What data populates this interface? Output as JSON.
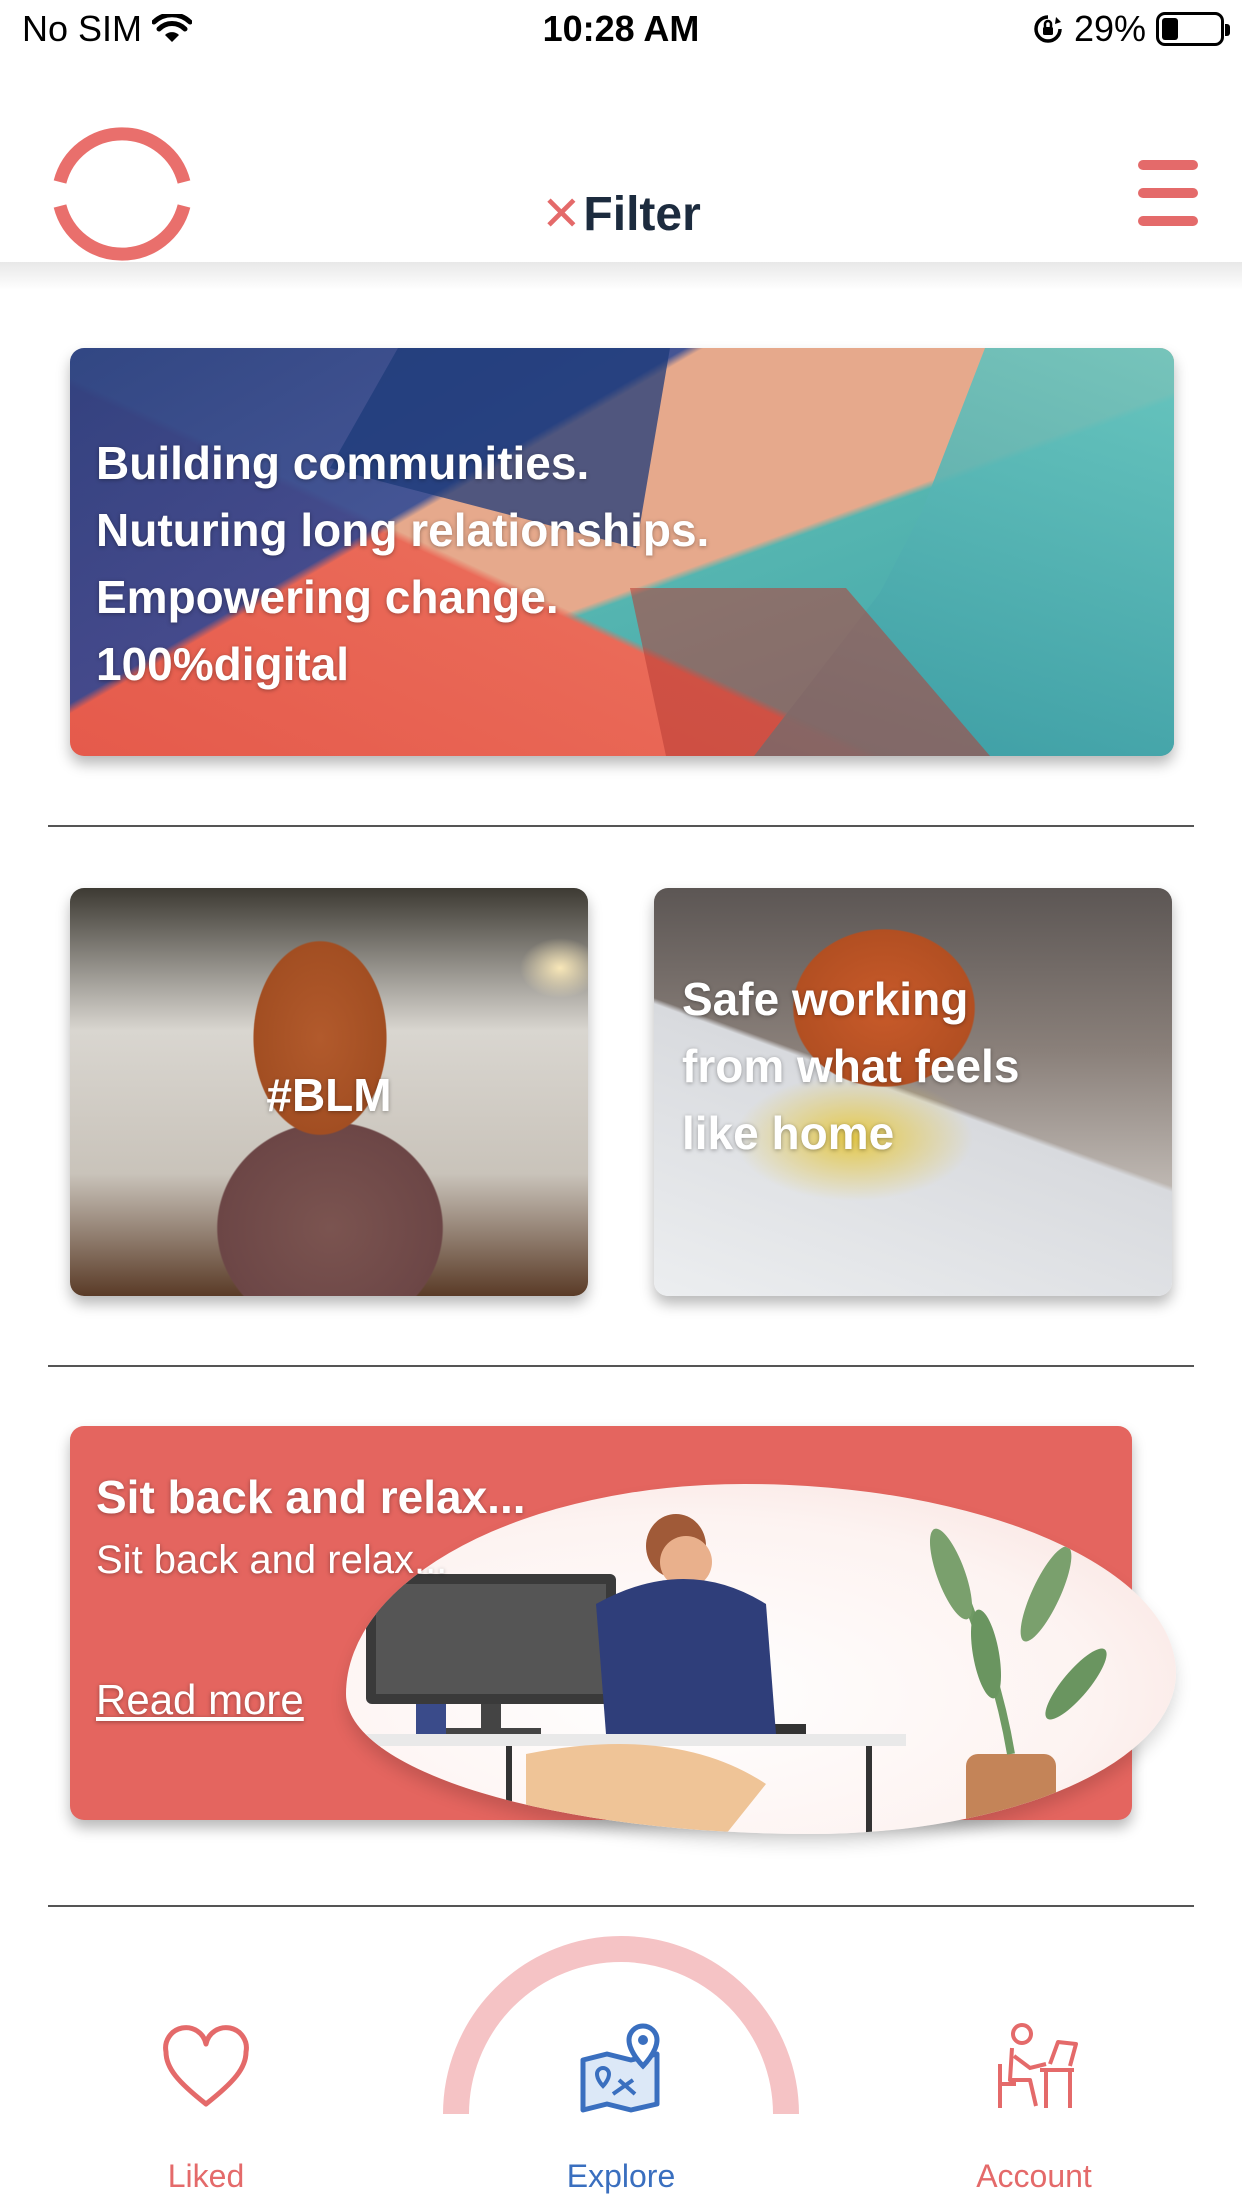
{
  "status_bar": {
    "carrier": "No SIM",
    "time": "10:28 AM",
    "battery_percent": "29%",
    "battery_level": 0.29,
    "icons": [
      "wifi-icon",
      "orientation-lock-icon",
      "battery-icon"
    ]
  },
  "header": {
    "filter_x": "✕",
    "filter_label": "Filter",
    "logo_icon": "ring-logo-icon",
    "menu_icon": "hamburger-menu-icon"
  },
  "cards": {
    "banner": {
      "lines": [
        "Building communities.",
        "Nuturing long relationships.",
        "Empowering change.",
        "100%digital"
      ]
    },
    "blm": {
      "text": "#BLM"
    },
    "safe_working": {
      "text": "Safe working from what feels like home"
    },
    "promo": {
      "title": "Sit back and relax...",
      "subtitle": "Sit back and relax...",
      "link": "Read more"
    }
  },
  "bottom_nav": {
    "items": [
      {
        "label": "Liked",
        "icon": "heart-icon"
      },
      {
        "label": "Explore",
        "icon": "map-pin-icon"
      },
      {
        "label": "Account",
        "icon": "person-at-desk-icon"
      }
    ],
    "active": "Explore"
  },
  "colors": {
    "accent": "#e46a6a",
    "nav_active": "#3a6fbf",
    "heading": "#1c2b3e",
    "promo_bg": "#e4655f",
    "arc": "#f5c3c5"
  }
}
